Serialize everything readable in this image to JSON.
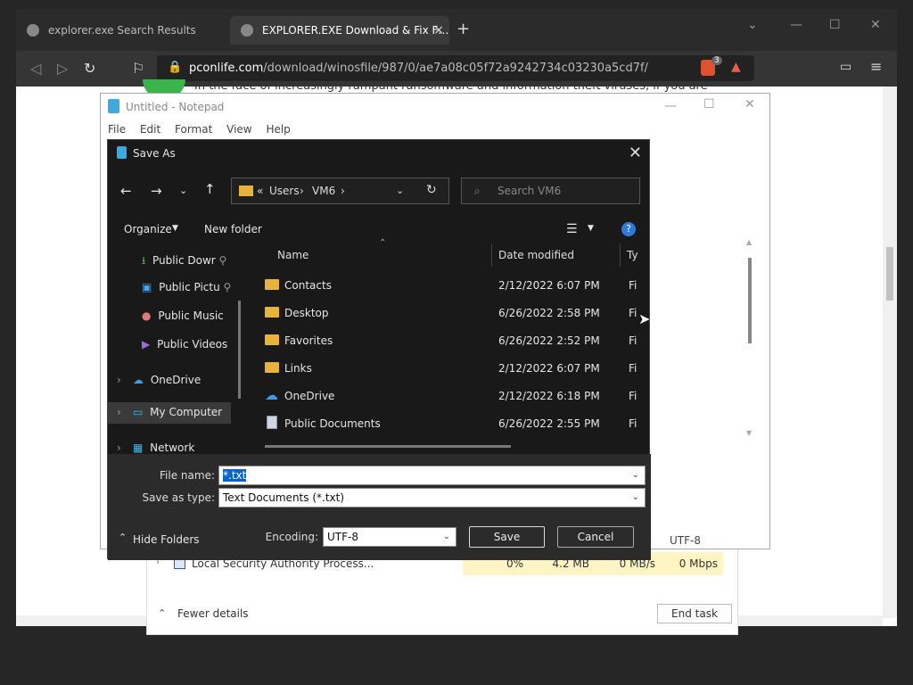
{
  "browser": {
    "tabs": [
      {
        "label": "explorer.exe Search Results"
      },
      {
        "label": "EXPLORER.EXE Download & Fix F…"
      }
    ],
    "tab_close": "×",
    "new_tab": "+",
    "url_domain": "pconlife.com",
    "url_path": "/download/winosfile/987/0/ae7a08c05f72a9242734c03230a5cd7f/",
    "shield_count": "3",
    "page_text": "In the face of increasingly rampant ransomware and information theft viruses, if you are"
  },
  "taskmanager": {
    "row_name": "Local Security Authority Process...",
    "cpu": "0%",
    "memory": "4.2 MB",
    "disk": "0 MB/s",
    "network": "0 Mbps",
    "fewer_details": "Fewer details",
    "end_task": "End task"
  },
  "notepad": {
    "title": "Untitled - Notepad",
    "menu": [
      "File",
      "Edit",
      "Format",
      "View",
      "Help"
    ],
    "status_encoding": "UTF-8"
  },
  "dialog": {
    "title": "Save As",
    "path": {
      "prefix": "«",
      "parts": [
        "Users",
        "VM6"
      ]
    },
    "search_placeholder": "Search VM6",
    "organize": "Organize",
    "new_folder": "New folder",
    "nav_items": [
      {
        "label": "Public Dowr"
      },
      {
        "label": "Public Pictu"
      },
      {
        "label": "Public Music"
      },
      {
        "label": "Public Videos"
      },
      {
        "label": "OneDrive"
      },
      {
        "label": "My Computer"
      },
      {
        "label": "Network"
      }
    ],
    "columns": {
      "name": "Name",
      "date": "Date modified",
      "type": "Ty"
    },
    "files": [
      {
        "name": "Contacts",
        "date": "2/12/2022 6:07 PM",
        "type": "Fi",
        "icon": "folder"
      },
      {
        "name": "Desktop",
        "date": "6/26/2022 2:58 PM",
        "type": "Fi",
        "icon": "folder"
      },
      {
        "name": "Favorites",
        "date": "6/26/2022 2:52 PM",
        "type": "Fi",
        "icon": "folder"
      },
      {
        "name": "Links",
        "date": "2/12/2022 6:07 PM",
        "type": "Fi",
        "icon": "folder"
      },
      {
        "name": "OneDrive",
        "date": "2/12/2022 6:18 PM",
        "type": "Fi",
        "icon": "cloud"
      },
      {
        "name": "Public Documents",
        "date": "6/26/2022 2:55 PM",
        "type": "Fi",
        "icon": "document"
      }
    ],
    "file_name_label": "File name:",
    "file_name_value": "*.txt",
    "save_type_label": "Save as type:",
    "save_type_value": "Text Documents (*.txt)",
    "hide_folders": "Hide Folders",
    "encoding_label": "Encoding:",
    "encoding_value": "UTF-8",
    "save": "Save",
    "cancel": "Cancel"
  }
}
